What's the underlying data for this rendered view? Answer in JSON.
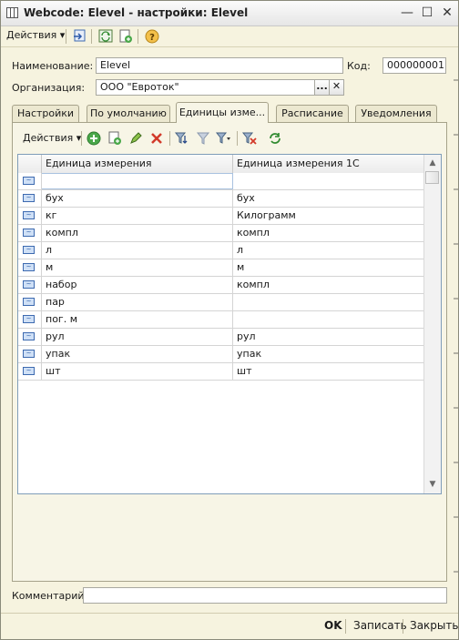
{
  "window": {
    "title": "Webcode: Elevel - настройки: Elevel"
  },
  "toolbar": {
    "actions_label": "Действия"
  },
  "form": {
    "name_label": "Наименование:",
    "name_value": "Elevel",
    "code_label": "Код:",
    "code_value": "000000001",
    "org_label": "Организация:",
    "org_value": "ООО \"Евроток\"",
    "org_select_btn": "...",
    "org_clear_btn": "✕"
  },
  "tabs": [
    {
      "label": "Настройки"
    },
    {
      "label": "По умолчанию"
    },
    {
      "label": "Единицы изме..."
    },
    {
      "label": "Расписание"
    },
    {
      "label": "Уведомления"
    }
  ],
  "grid": {
    "actions_label": "Действия",
    "columns": [
      "Единица измерения",
      "Единица измерения 1С"
    ],
    "rows": [
      {
        "c1": "",
        "c2": ""
      },
      {
        "c1": "бух",
        "c2": "бух"
      },
      {
        "c1": "кг",
        "c2": "Килограмм"
      },
      {
        "c1": "компл",
        "c2": "компл"
      },
      {
        "c1": "л",
        "c2": "л"
      },
      {
        "c1": "м",
        "c2": "м"
      },
      {
        "c1": "набор",
        "c2": "компл"
      },
      {
        "c1": "пар",
        "c2": ""
      },
      {
        "c1": "пог. м",
        "c2": ""
      },
      {
        "c1": "рул",
        "c2": "рул"
      },
      {
        "c1": "упак",
        "c2": "упак"
      },
      {
        "c1": "шт",
        "c2": "шт"
      }
    ]
  },
  "comment": {
    "label": "Комментарий:",
    "value": ""
  },
  "footer": {
    "ok": "OK",
    "save": "Записать",
    "close": "Закрыть"
  },
  "colors": {
    "accent": "#3d6ab0",
    "panel": "#f7f5e6",
    "background": "#f4f1dc"
  }
}
